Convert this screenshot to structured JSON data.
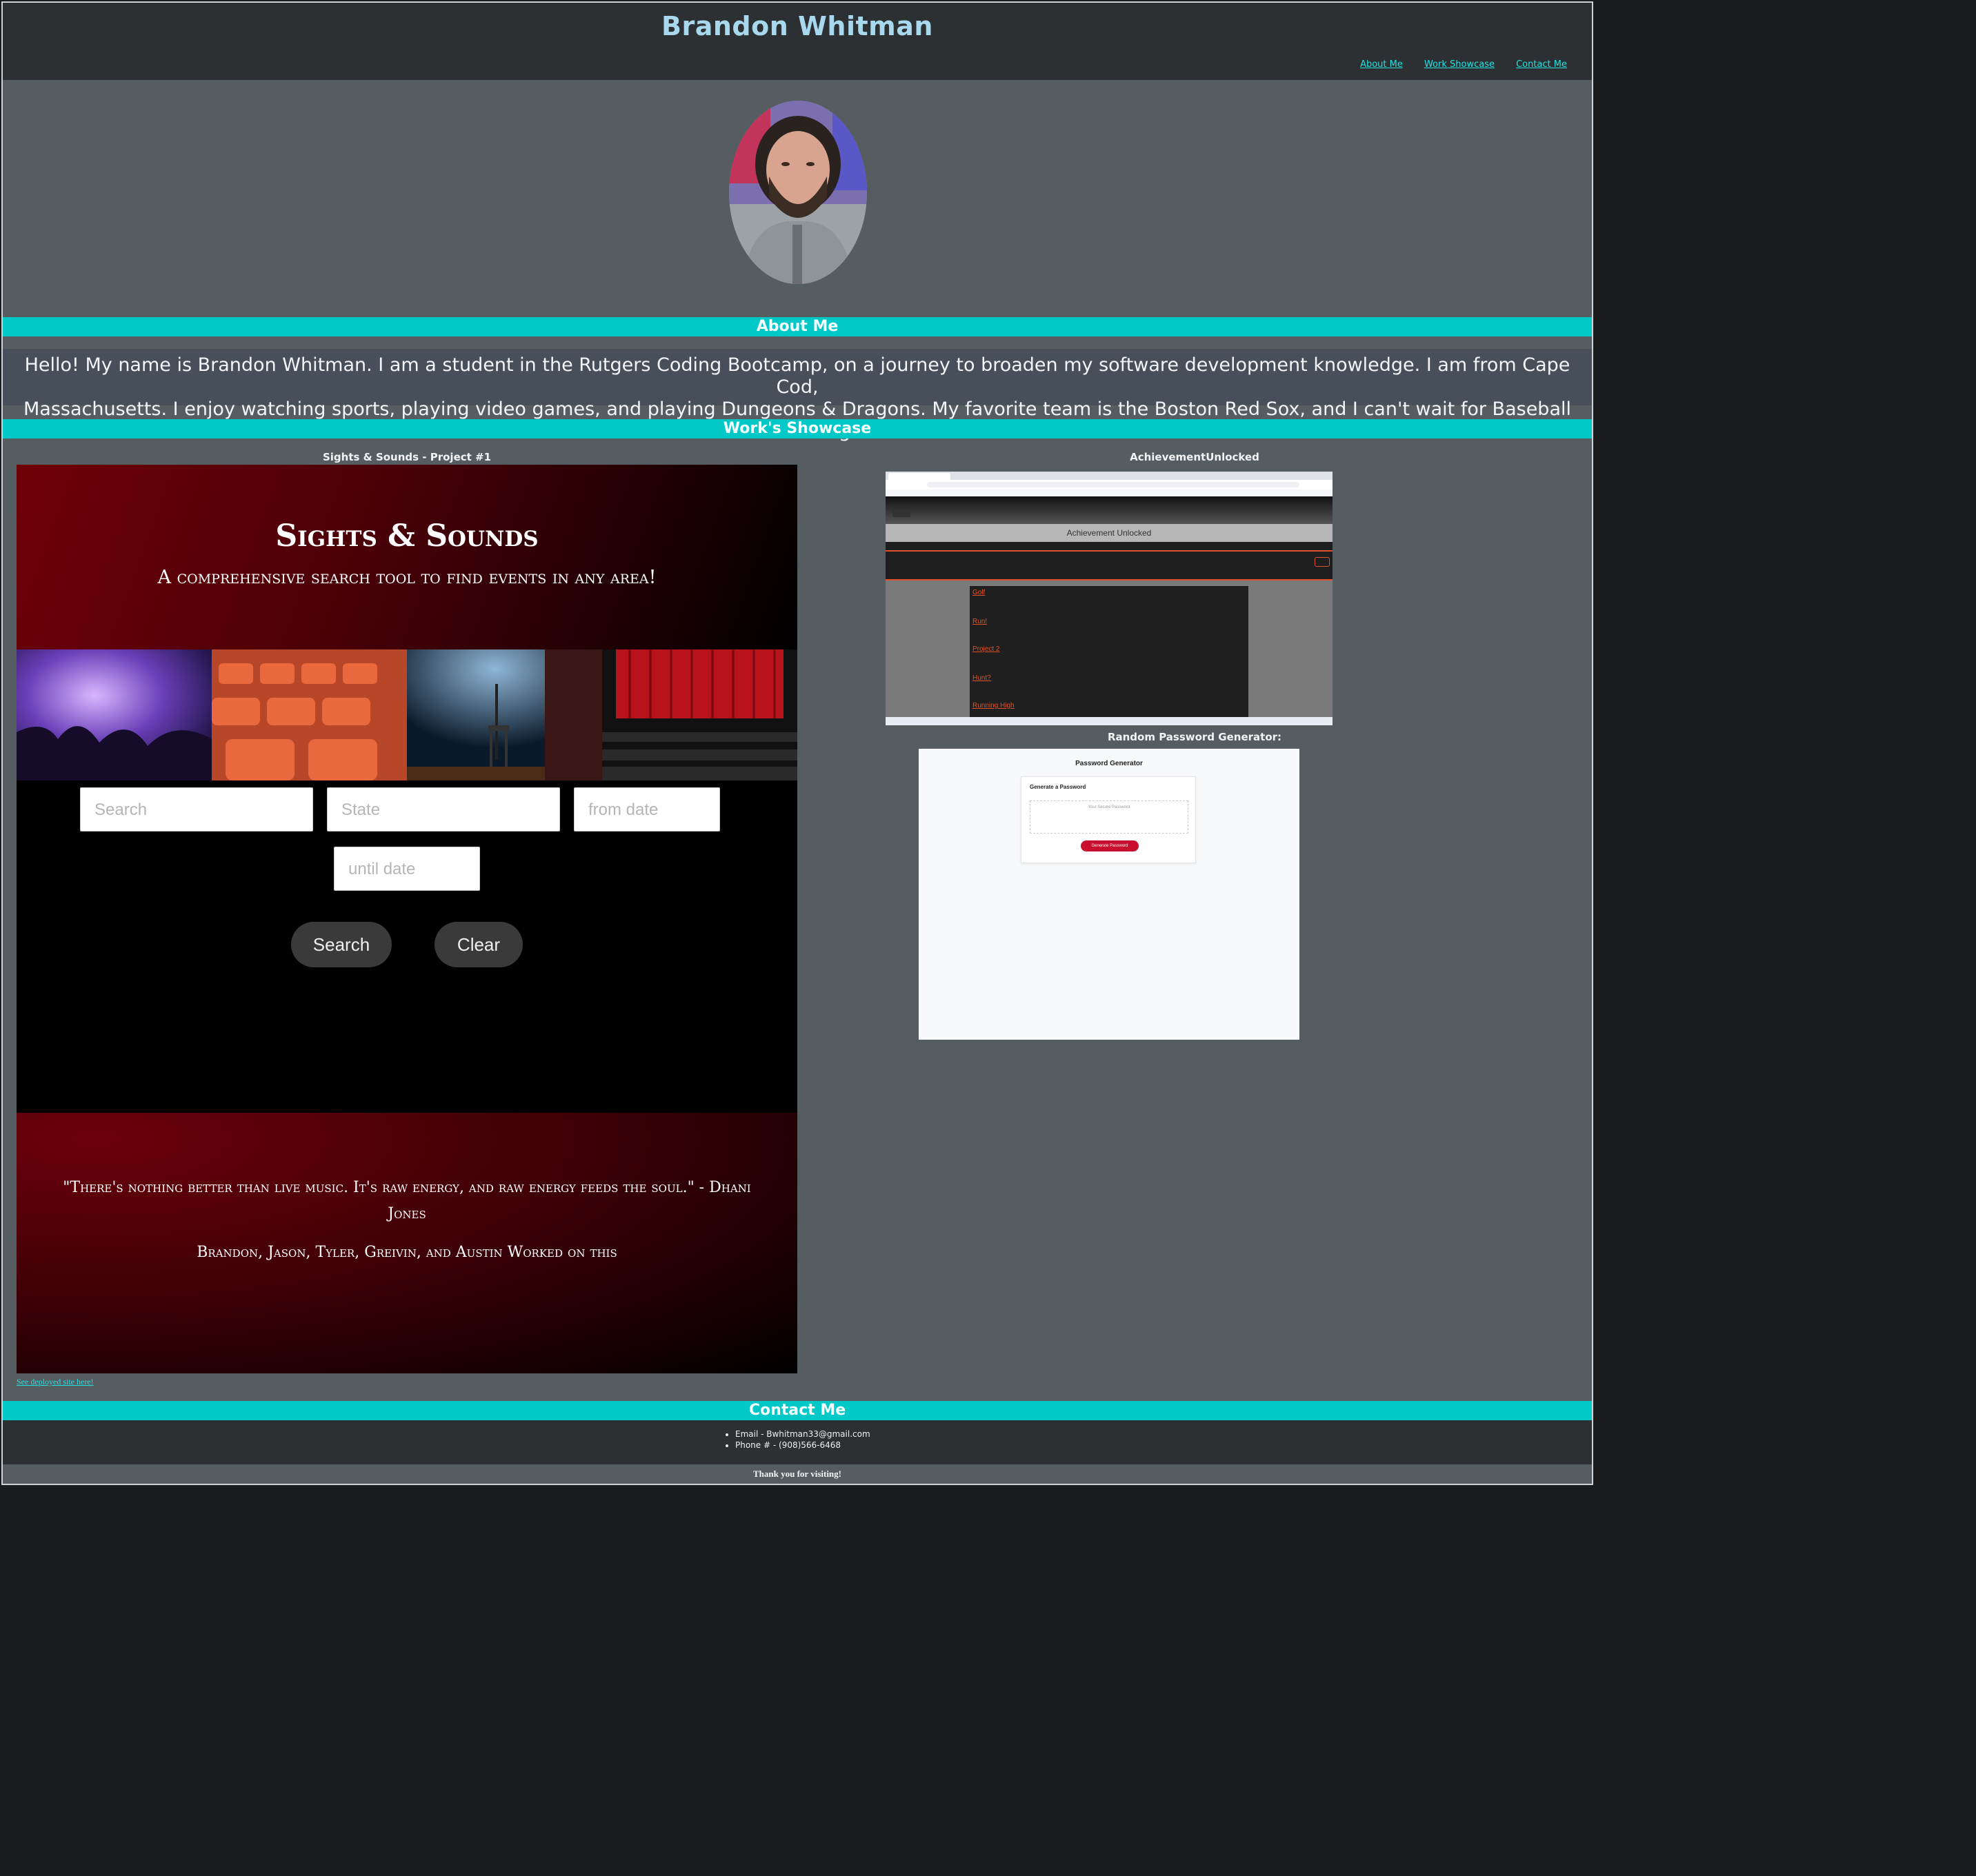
{
  "header": {
    "title": "Brandon Whitman",
    "nav": [
      "About Me",
      "Work Showcase",
      "Contact Me"
    ]
  },
  "about": {
    "heading": "About Me",
    "line1": "Hello! My name is Brandon Whitman. I am a student in the Rutgers Coding Bootcamp, on a journey to broaden my software development knowledge. I am from Cape Cod,",
    "line2": "Massachusetts. I enjoy watching sports, playing video games, and playing Dungeons & Dragons. My favorite team is the Boston Red Sox, and I can't wait for Baseball season to begin!"
  },
  "showcase": {
    "heading": "Work's Showcase",
    "project1": {
      "title": "Sights & Sounds - Project #1",
      "brand": "Sights & Sounds",
      "tagline": "A comprehensive search tool to find events in any area!",
      "search_placeholder": "Search",
      "state_placeholder": "State",
      "from_placeholder": "from date",
      "until_placeholder": "until date",
      "search_button": "Search",
      "clear_button": "Clear",
      "quote": "\"There's nothing better than live music. It's raw energy, and raw energy feeds the soul.\" - Dhani Jones",
      "credits": "Brandon, Jason, Tyler, Greivin, and Austin Worked on this",
      "link": "See deployed site here!"
    },
    "project2": {
      "title": "AchievementUnlocked",
      "app_title": "Achievement Unlocked",
      "items": [
        "Golf",
        "Run!",
        "Project 2",
        "Hunt?",
        "Running High"
      ]
    },
    "project3": {
      "title": "Random Password Generator:",
      "app_title": "Password Generator",
      "card_title": "Generate a Password",
      "field_placeholder": "Your Secure Password",
      "button": "Generate Password"
    }
  },
  "contact": {
    "heading": "Contact Me",
    "email": "Email - Bwhitman33@gmail.com",
    "phone": "Phone # - (908)566-6468"
  },
  "footer": {
    "thanks": "Thank you for visiting!"
  },
  "colors": {
    "accent": "#02c9c7",
    "link": "#22e2e2",
    "header_bg": "#2c3033",
    "page_bg": "#555d61"
  }
}
